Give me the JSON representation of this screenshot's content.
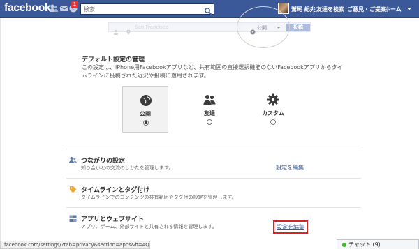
{
  "header": {
    "logo": "facebook",
    "notification_count": "1",
    "search": {
      "placeholder": "検索",
      "value": ""
    },
    "user_name": "鷲尾 紀夫",
    "find_friends": "友達を検索",
    "help": "ご意見・ご提案",
    "home": "ホーム"
  },
  "composer_preview": {
    "location": "San Francisco",
    "audience": "公開",
    "post_button": "投稿"
  },
  "default_settings": {
    "title": "デフォルト設定の管理",
    "description": "この設定は、iPhone用Facebookアプリなど、共有範囲の直接選択機能のないFacebookアプリからタイムラインに投稿された近況や投稿に適用されます。",
    "options": [
      {
        "label": "公開",
        "icon": "globe-icon",
        "selected": true
      },
      {
        "label": "友達",
        "icon": "friends-icon",
        "selected": false
      },
      {
        "label": "カスタム",
        "icon": "gear-icon",
        "selected": false
      }
    ]
  },
  "sections": [
    {
      "title": "つながりの設定",
      "description": "知り合いとの交流のしかたを管理します。",
      "link": "設定を編集",
      "icon": "friends-icon"
    },
    {
      "title": "タイムラインとタグ付け",
      "description": "タイムラインでのコンテンツの共有範囲やタグ付の設定を管理します。",
      "link": "設定を編集",
      "icon": "tag-icon"
    },
    {
      "title": "アプリとウェブサイト",
      "description": "アプリ、ゲーム、外部サイトと共有される情報を管理します。",
      "link": "設定を編集",
      "icon": "apps-icon"
    }
  ],
  "status_url": "facebook.com/settings/?tab=privacy&section=apps&h=AQ···",
  "chat": {
    "label": "チャット (9)"
  },
  "colors": {
    "brand": "#3b5998",
    "highlight": "#dd2222"
  }
}
